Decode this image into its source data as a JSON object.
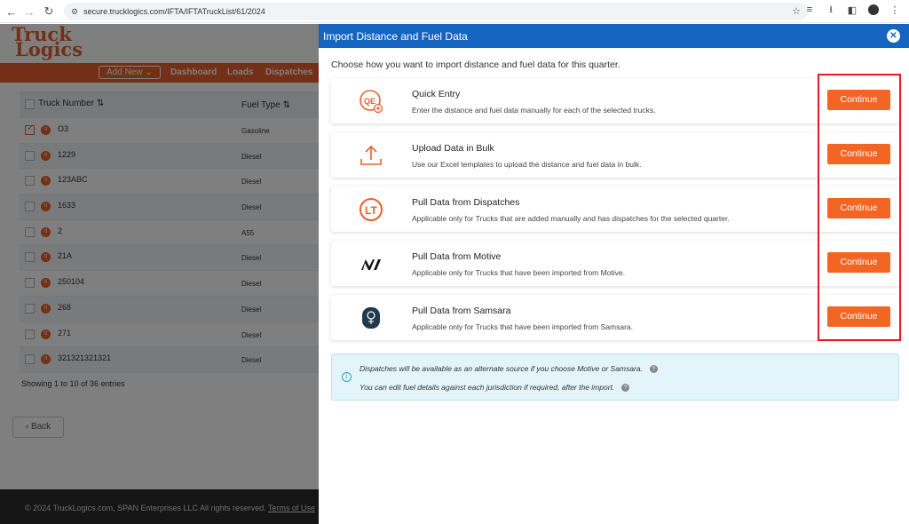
{
  "browser": {
    "url": "secure.trucklogics.com/IFTA/IFTATruckList/61/2024"
  },
  "app": {
    "logo_line1": "Truck",
    "logo_line2": "Logics",
    "nav": {
      "add_new": "Add New",
      "dashboard": "Dashboard",
      "loads": "Loads",
      "dispatches": "Dispatches"
    },
    "table": {
      "col_truck": "Truck Number",
      "col_fuel": "Fuel Type",
      "rows": [
        {
          "truck": "O3",
          "fuel": "Gasoline",
          "checked": true
        },
        {
          "truck": "1229",
          "fuel": "Diesel"
        },
        {
          "truck": "123ABC",
          "fuel": "Diesel"
        },
        {
          "truck": "1633",
          "fuel": "Diesel"
        },
        {
          "truck": "2",
          "fuel": "A55"
        },
        {
          "truck": "21A",
          "fuel": "Diesel"
        },
        {
          "truck": "250104",
          "fuel": "Diesel"
        },
        {
          "truck": "268",
          "fuel": "Diesel"
        },
        {
          "truck": "271",
          "fuel": "Diesel"
        },
        {
          "truck": "321321321321",
          "fuel": "Diesel"
        }
      ],
      "showing": "Showing 1 to 10 of 36 entries"
    },
    "back": "Back",
    "footer": "© 2024 TruckLogics.com, SPAN Enterprises LLC All rights reserved.",
    "footer_terms": "Terms of Use"
  },
  "modal": {
    "title": "Import Distance and Fuel Data",
    "intro": "Choose how you want to import distance and fuel data for this quarter.",
    "options": [
      {
        "title": "Quick Entry",
        "desc": "Enter the distance and fuel data manually for each of the selected trucks.",
        "button": "Continue",
        "icon": "quick-entry-icon"
      },
      {
        "title": "Upload Data in Bulk",
        "desc": "Use our Excel templates to upload the distance and fuel data in bulk.",
        "button": "Continue",
        "icon": "upload-icon"
      },
      {
        "title": "Pull Data from Dispatches",
        "desc": "Applicable only for Trucks that are added manually and has dispatches for the selected quarter.",
        "button": "Continue",
        "icon": "trucklogics-icon"
      },
      {
        "title": "Pull Data from Motive",
        "desc": "Applicable only for Trucks that have been imported from Motive.",
        "button": "Continue",
        "icon": "motive-icon"
      },
      {
        "title": "Pull Data from Samsara",
        "desc": "Applicable only for Trucks that have been imported from Samsara.",
        "button": "Continue",
        "icon": "samsara-icon"
      }
    ],
    "info": {
      "line1": "Dispatches will be available as an alternate source if you choose Motive or Samsara.",
      "line2": "You can edit fuel details against each jurisdiction if required, after the import."
    }
  }
}
